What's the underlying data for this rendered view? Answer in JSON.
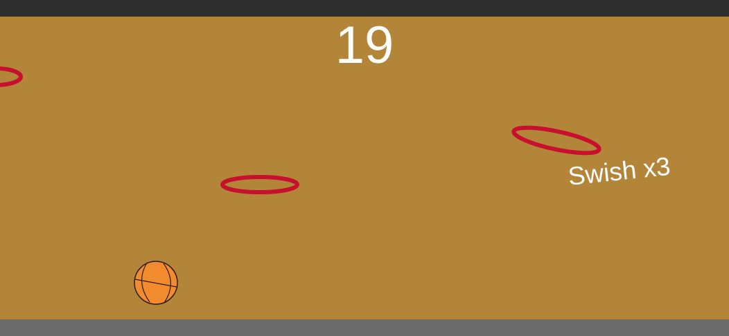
{
  "game": {
    "score": "19",
    "combo_text": "Swish x3"
  },
  "colors": {
    "court": "#b38538",
    "hoop_rim": "#c8102e",
    "ball": "#f28a2e",
    "top_bar": "#2e2e2e",
    "bottom_bar": "#6b6b6b",
    "text": "#ffffff"
  },
  "icons": {
    "ball": "basketball-icon",
    "hoop": "hoop-ring-icon"
  }
}
